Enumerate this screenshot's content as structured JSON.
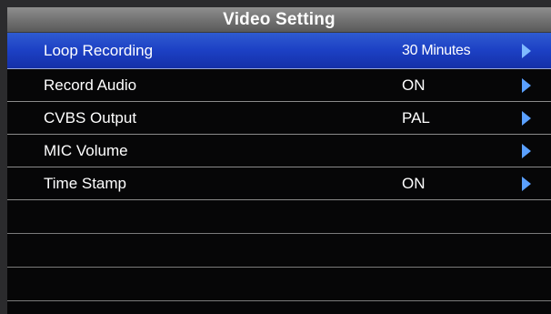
{
  "title": "Video Setting",
  "items": [
    {
      "label": "Loop Recording",
      "value": "30 Minutes",
      "arrow_icon": "right-arrow-icon"
    },
    {
      "label": "Record Audio",
      "value": "ON",
      "arrow_icon": "right-arrow-icon"
    },
    {
      "label": "CVBS Output",
      "value": "PAL",
      "arrow_icon": "right-arrow-icon"
    },
    {
      "label": "MIC Volume",
      "value": "",
      "arrow_icon": "right-arrow-icon"
    },
    {
      "label": "Time Stamp",
      "value": "ON",
      "arrow_icon": "right-arrow-icon"
    }
  ],
  "selected_index": 0,
  "colors": {
    "selection": "#1c40c4",
    "arrow": "#5aa0ff",
    "background": "#060607",
    "title_bar": "#707070"
  }
}
